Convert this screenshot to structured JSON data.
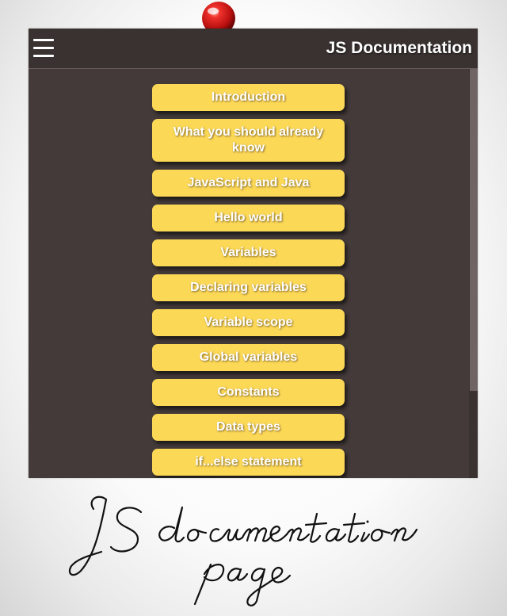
{
  "header": {
    "title": "JS Documentation",
    "menu_icon": "hamburger-menu-icon"
  },
  "nav": {
    "items": [
      {
        "label": "Introduction"
      },
      {
        "label": "What you should already know"
      },
      {
        "label": "JavaScript and Java"
      },
      {
        "label": "Hello world"
      },
      {
        "label": "Variables"
      },
      {
        "label": "Declaring variables"
      },
      {
        "label": "Variable scope"
      },
      {
        "label": "Global variables"
      },
      {
        "label": "Constants"
      },
      {
        "label": "Data types"
      },
      {
        "label": "if...else statement"
      }
    ]
  },
  "decorations": {
    "pin_icon": "pushpin-icon",
    "caption_text": "JS documentation page"
  },
  "colors": {
    "panel": "#433a39",
    "header": "#3a3231",
    "button": "#fcd857",
    "button_text": "#ffffff",
    "pin": "#e0191b"
  }
}
